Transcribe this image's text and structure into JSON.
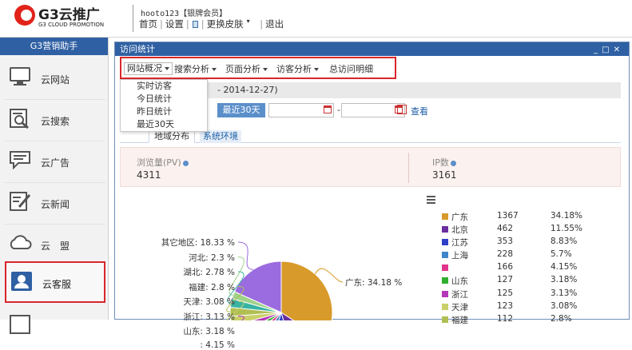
{
  "header": {
    "logo_text": "G3云推广",
    "logo_sub": "G3 CLOUD PROMOTION",
    "username": "hooto123",
    "member_level": "【银牌会员】",
    "nav": {
      "home": "首页",
      "settings": "设置",
      "skin": "更换皮肤",
      "logout": "退出"
    }
  },
  "sidebar": {
    "title": "G3营销助手",
    "items": [
      {
        "label": "云网站"
      },
      {
        "label": "云搜索"
      },
      {
        "label": "云广告"
      },
      {
        "label": "云新闻"
      },
      {
        "label": "云　盟"
      },
      {
        "label": "云客服"
      }
    ]
  },
  "panel": {
    "title": "访问统计",
    "toolbar": [
      "网站概况",
      "搜索分析",
      "页面分析",
      "访客分析",
      "总访问明细"
    ],
    "dropdown": [
      "实时访客",
      "今日统计",
      "昨日统计",
      "最近30天"
    ],
    "date_range_text": "- 2014-12-27)",
    "btn_30days": "最近30天",
    "date_dash": "-",
    "view_link": "查看",
    "subtabs": [
      "地域分布",
      "系统环境"
    ],
    "stats": {
      "pv_label": "浏览量(PV)",
      "pv_value": "4311",
      "ip_label": "IP数",
      "ip_value": "3161"
    }
  },
  "chart_data": {
    "type": "pie",
    "slices": [
      {
        "name": "广东",
        "value": 1367,
        "pct": "34.18%",
        "color": "#d89a2a"
      },
      {
        "name": "北京",
        "value": 462,
        "pct": "11.55%",
        "color": "#6b2fa0"
      },
      {
        "name": "江苏",
        "value": 353,
        "pct": "8.83%",
        "color": "#2f3fc7"
      },
      {
        "name": "上海",
        "value": 228,
        "pct": "5.7%",
        "color": "#3f86c9"
      },
      {
        "name": "",
        "value": 166,
        "pct": "4.15%",
        "color": "#e0338a"
      },
      {
        "name": "山东",
        "value": 127,
        "pct": "3.18%",
        "color": "#2fae2f"
      },
      {
        "name": "浙江",
        "value": 125,
        "pct": "3.13%",
        "color": "#b436b9"
      },
      {
        "name": "天津",
        "value": 123,
        "pct": "3.08%",
        "color": "#c9d06a"
      },
      {
        "name": "福建",
        "value": 112,
        "pct": "2.8%",
        "color": "#b0bf52"
      },
      {
        "name": "湖北",
        "value": 111,
        "pct": "2.78%",
        "color": "#39b3a3"
      },
      {
        "name": "河北",
        "value": 92,
        "pct": "2.3%",
        "color": "#a0d28a"
      },
      {
        "name": "其它地区",
        "value": 733,
        "pct": "18.33%",
        "color": "#9b6be0"
      }
    ],
    "pie_labels": [
      {
        "text": "其它地区: 18.33 %"
      },
      {
        "text": "河北: 2.3 %"
      },
      {
        "text": "湖北: 2.78 %"
      },
      {
        "text": "福建: 2.8 %"
      },
      {
        "text": "天津: 3.08 %"
      },
      {
        "text": "浙江: 3.13 %"
      },
      {
        "text": "山东: 3.18 %"
      },
      {
        "text": ": 4.15 %"
      },
      {
        "text": "广东: 34.18 %"
      }
    ]
  },
  "colors": {
    "brand_blue": "#2f60a3",
    "highlight_red": "#d9262c",
    "logo_red": "#e2231a"
  }
}
